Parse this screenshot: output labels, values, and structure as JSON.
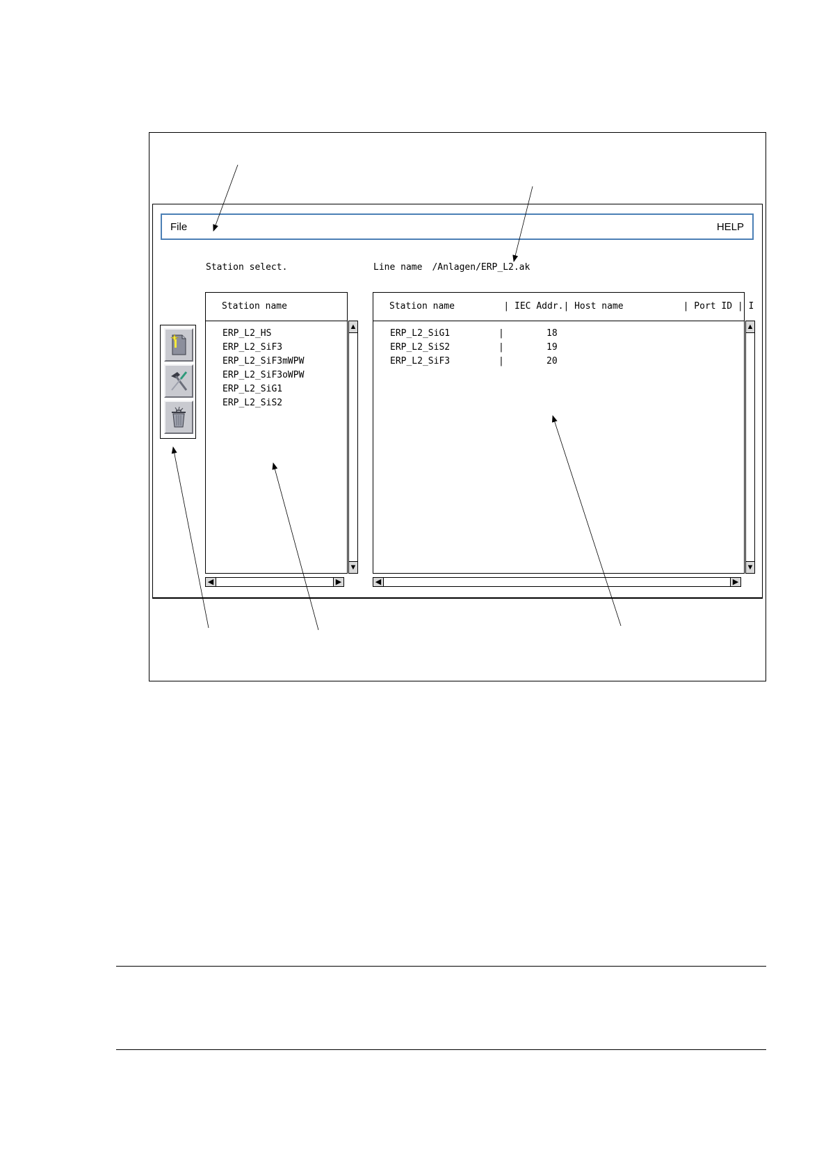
{
  "menu": {
    "file": "File",
    "help": "HELP"
  },
  "labels": {
    "station_select": "Station select.",
    "line_name_label": "Line name",
    "line_name_value": "/Anlagen/ERP_L2.ak"
  },
  "toolbar": {
    "buttons": [
      {
        "icon": "new-document-icon"
      },
      {
        "icon": "hammer-screwdriver-icon"
      },
      {
        "icon": "trash-can-icon"
      }
    ]
  },
  "left_list": {
    "header": "Station name",
    "items": [
      "ERP_L2_HS",
      "ERP_L2_SiF3",
      "ERP_L2_SiF3mWPW",
      "ERP_L2_SiF3oWPW",
      "ERP_L2_SiG1",
      "ERP_L2_SiS2"
    ]
  },
  "right_table": {
    "header": "Station name         | IEC Addr.| Host name           | Port ID | I",
    "rows": [
      {
        "station": "ERP_L2_SiG1",
        "sep": "|",
        "iec": "18"
      },
      {
        "station": "ERP_L2_SiS2",
        "sep": "|",
        "iec": "19"
      },
      {
        "station": "ERP_L2_SiF3",
        "sep": "|",
        "iec": "20"
      }
    ]
  },
  "scrollbars": {
    "up": "▲",
    "down": "▼",
    "left": "◀",
    "right": "▶"
  }
}
